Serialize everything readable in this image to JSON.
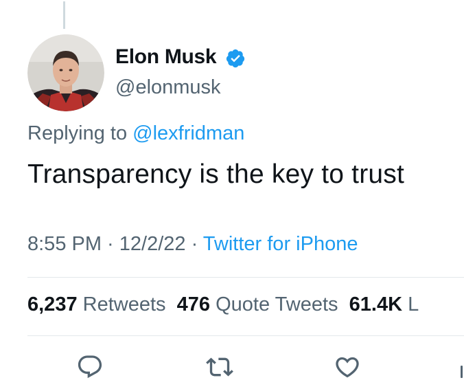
{
  "tweet": {
    "author": {
      "display_name": "Elon Musk",
      "handle": "@elonmusk",
      "verified_icon": "verified-badge-icon",
      "avatar_icon": "profile-avatar"
    },
    "reply": {
      "prefix": "Replying to ",
      "mention": "@lexfridman"
    },
    "text": "Transparency is the key to trust",
    "meta": {
      "time": "8:55 PM",
      "separator": " · ",
      "date": "12/2/22",
      "source": "Twitter for iPhone"
    },
    "stats": {
      "retweets_count": "6,237",
      "retweets_label": " Retweets",
      "quotes_count": "476",
      "quotes_label": " Quote Tweets",
      "likes_count": "61.4K",
      "likes_label": " L"
    },
    "actions": [
      "reply-icon",
      "retweet-icon",
      "like-icon",
      "share-icon"
    ]
  },
  "colors": {
    "text": "#0f1419",
    "secondary": "#536471",
    "accent": "#1d9bf0",
    "divider": "#e3e8eb"
  }
}
